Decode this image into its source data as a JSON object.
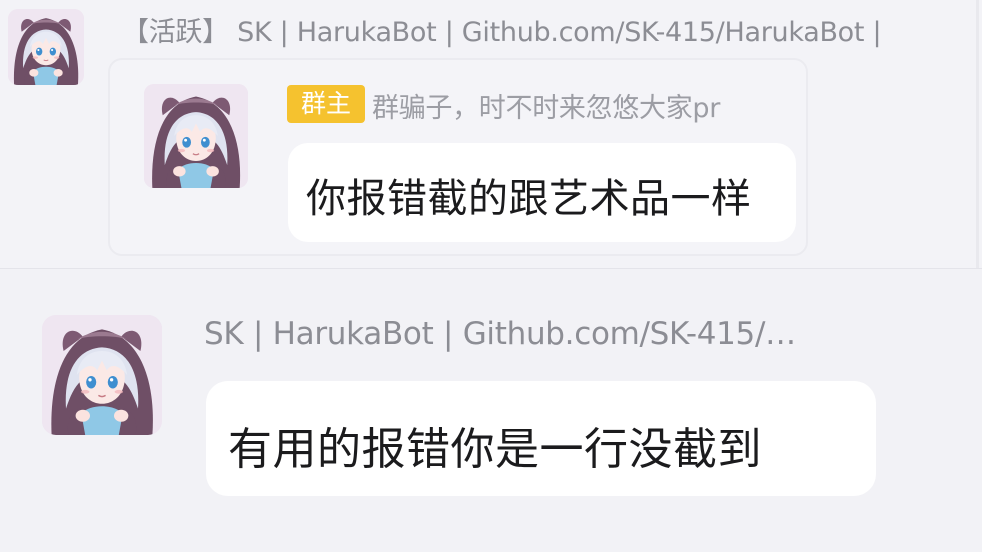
{
  "top_message": {
    "active_tag": "【活跃】",
    "sender_name": "SK | HarukaBot | Github.com/SK-415/HarukaBot |",
    "avatar_icon": "anime-girl-avatar-icon"
  },
  "quoted_message": {
    "role_badge": "群主",
    "sender_name": "群骗子，时不时来忽悠大家pr",
    "text": "你报错截的跟艺术品一样",
    "avatar_icon": "anime-girl-avatar-icon",
    "badge_color": "#f5c22f"
  },
  "main_message": {
    "sender_name": "SK | HarukaBot | Github.com/SK-415/…",
    "text": "有用的报错你是一行没截到",
    "avatar_icon": "anime-girl-avatar-icon"
  }
}
